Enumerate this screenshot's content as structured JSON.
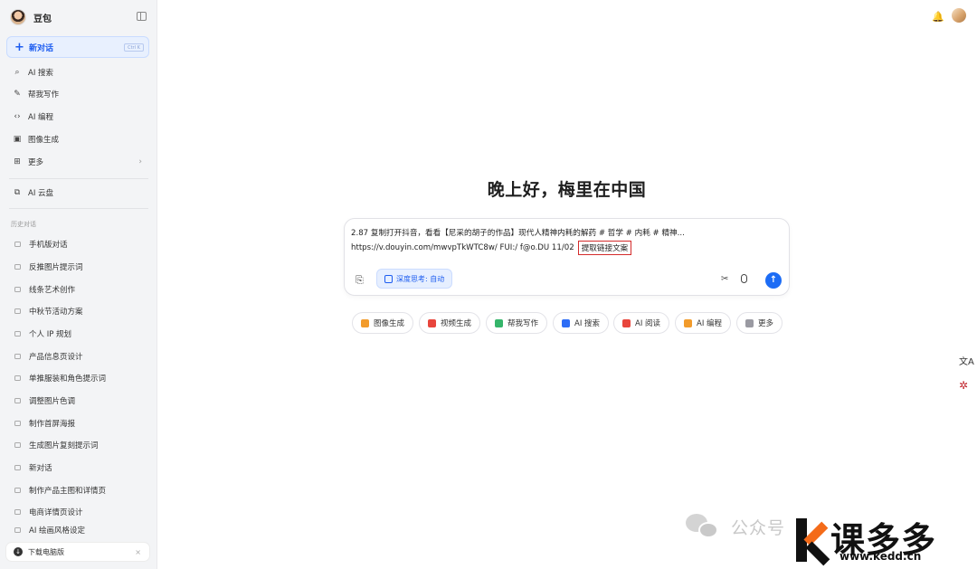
{
  "app": {
    "name": "豆包"
  },
  "sidebar": {
    "new_chat": {
      "label": "新对话",
      "shortcut": "Ctrl K"
    },
    "nav": [
      {
        "label": "AI 搜索",
        "icon": "search-icon"
      },
      {
        "label": "帮我写作",
        "icon": "pen-icon"
      },
      {
        "label": "AI 编程",
        "icon": "code-icon"
      },
      {
        "label": "图像生成",
        "icon": "image-icon"
      },
      {
        "label": "更多",
        "icon": "grid-icon"
      }
    ],
    "cloud": {
      "label": "AI 云盘",
      "icon": "cloud-drive-icon"
    },
    "history_label": "历史对话",
    "history": [
      "手机版对话",
      "反推图片提示词",
      "线条艺术创作",
      "中秋节活动方案",
      "个人 IP 规划",
      "产品信息页设计",
      "单推服装和角色提示词",
      "调整图片色调",
      "制作首屏海报",
      "生成图片复刻提示词",
      "新对话",
      "制作产品主图和详情页",
      "电商详情页设计",
      "AI 绘画风格设定"
    ],
    "download": {
      "label": "下载电脑版"
    }
  },
  "main": {
    "greeting": "晚上好，梅里在中国",
    "input": {
      "line1": "2.87 复制打开抖音，看看【尼采的胡子的作品】现代人精神内耗的解药 # 哲学 # 内耗 # 精神...",
      "line2": "https://v.douyin.com/mwvpTkWTC8w/ FUI:/ f@o.DU 11/02",
      "highlight": "提取链接文案",
      "deep_think": "深度思考: 自动"
    },
    "quick_actions": [
      {
        "label": "图像生成",
        "color": "#f29b2b"
      },
      {
        "label": "视频生成",
        "color": "#e8453c"
      },
      {
        "label": "帮我写作",
        "color": "#35b56a"
      },
      {
        "label": "AI 搜索",
        "color": "#2d6df6"
      },
      {
        "label": "AI 阅读",
        "color": "#e8453c"
      },
      {
        "label": "AI 编程",
        "color": "#f29b2b"
      },
      {
        "label": "更多",
        "color": "#9a9aa2"
      }
    ]
  },
  "watermark": {
    "wechat_text": "公众号",
    "brand": "课多多",
    "url": "www.kedd.cn"
  }
}
